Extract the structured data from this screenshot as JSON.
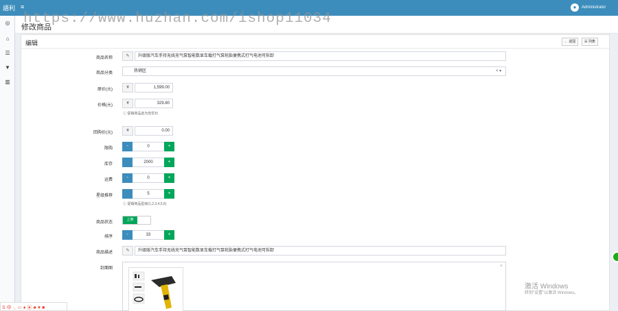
{
  "header": {
    "brand": "語利",
    "menu_icon": "hamburger-icon",
    "user_name": "Administrator"
  },
  "sidebar": {
    "icons": [
      "dashboard-icon",
      "bank-icon",
      "list-icon",
      "cart-icon",
      "chart-icon"
    ]
  },
  "page": {
    "title": "修改商品",
    "watermark": "https://www.huzhan.com/ishop11034"
  },
  "panel": {
    "title": "编辑",
    "back_label": "← 返回",
    "list_label": "☰ 列表"
  },
  "form": {
    "name": {
      "label": "商品名称",
      "icon": "pencil-icon",
      "value": "升级版汽车手持无线充气泵智能数显车载打气泵轮胎便携式打气电池可拆卸"
    },
    "category": {
      "label": "商品分类",
      "value": "热销区"
    },
    "original_price": {
      "label": "原价(元)",
      "currency": "¥",
      "value": "1,599.00"
    },
    "price": {
      "label": "价格(元)",
      "currency": "¥",
      "value": "329.80",
      "help": "ⓘ 促销商品此为省优价"
    },
    "rebate": {
      "label": "回购价(元)",
      "currency": "¥",
      "value": "0.00"
    },
    "limit": {
      "label": "限购",
      "value": "0"
    },
    "stock": {
      "label": "库存",
      "value": "2000"
    },
    "freight": {
      "label": "运费",
      "value": "0"
    },
    "star": {
      "label": "星级推荐",
      "value": "5",
      "help": "ⓘ 促销商品星级(1,2,3,4,5,6)"
    },
    "status": {
      "label": "商品状态",
      "on_label": "上架"
    },
    "sort": {
      "label": "排序",
      "value": "33"
    },
    "desc": {
      "label": "商品描述",
      "icon": "pencil-icon",
      "value": "升级版汽车手持无线充气泵智能数显车载打气泵轮胎便携式打气电池可拆卸"
    },
    "cover": {
      "label": "封面图",
      "close": "×"
    }
  },
  "stepper": {
    "minus": "-",
    "plus": "+"
  },
  "windows": {
    "line1": "激活 Windows",
    "line2": "转到\"设置\"以激活 Windows。"
  },
  "taskbar": {
    "text": "S 中 ·, ☺ ♦ ▣ ♣ ♥ ■"
  },
  "colors": {
    "header": "#3c8dbc",
    "plus": "#00a65a",
    "minus": "#3c8dbc"
  }
}
